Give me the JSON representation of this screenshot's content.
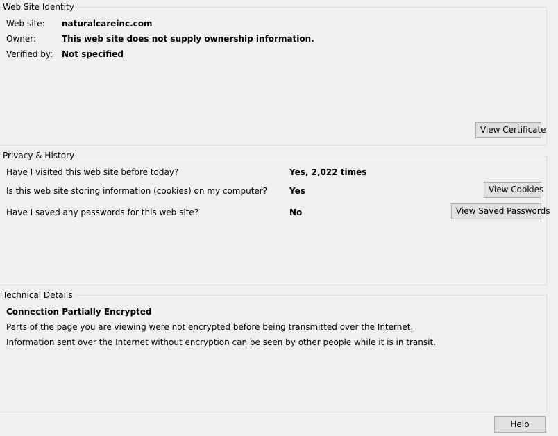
{
  "identity": {
    "title": "Web Site Identity",
    "website_label": "Web site:",
    "website_value": "naturalcareinc.com",
    "owner_label": "Owner:",
    "owner_value": "This web site does not supply ownership information.",
    "verified_label": "Verified by:",
    "verified_value": "Not specified",
    "view_certificate_button": "View Certificate"
  },
  "privacy": {
    "title": "Privacy & History",
    "rows": [
      {
        "question": "Have I visited this web site before today?",
        "answer": "Yes, 2,022 times"
      },
      {
        "question": "Is this web site storing information (cookies) on my computer?",
        "answer": "Yes",
        "button": "View Cookies"
      },
      {
        "question": "Have I saved any passwords for this web site?",
        "answer": "No",
        "button": "View Saved Passwords"
      }
    ]
  },
  "technical": {
    "title": "Technical Details",
    "heading": "Connection Partially Encrypted",
    "line1": "Parts of the page you are viewing were not encrypted before being transmitted over the Internet.",
    "line2": "Information sent over the Internet without encryption can be seen by other people while it is in transit."
  },
  "footer": {
    "help_button": "Help"
  }
}
